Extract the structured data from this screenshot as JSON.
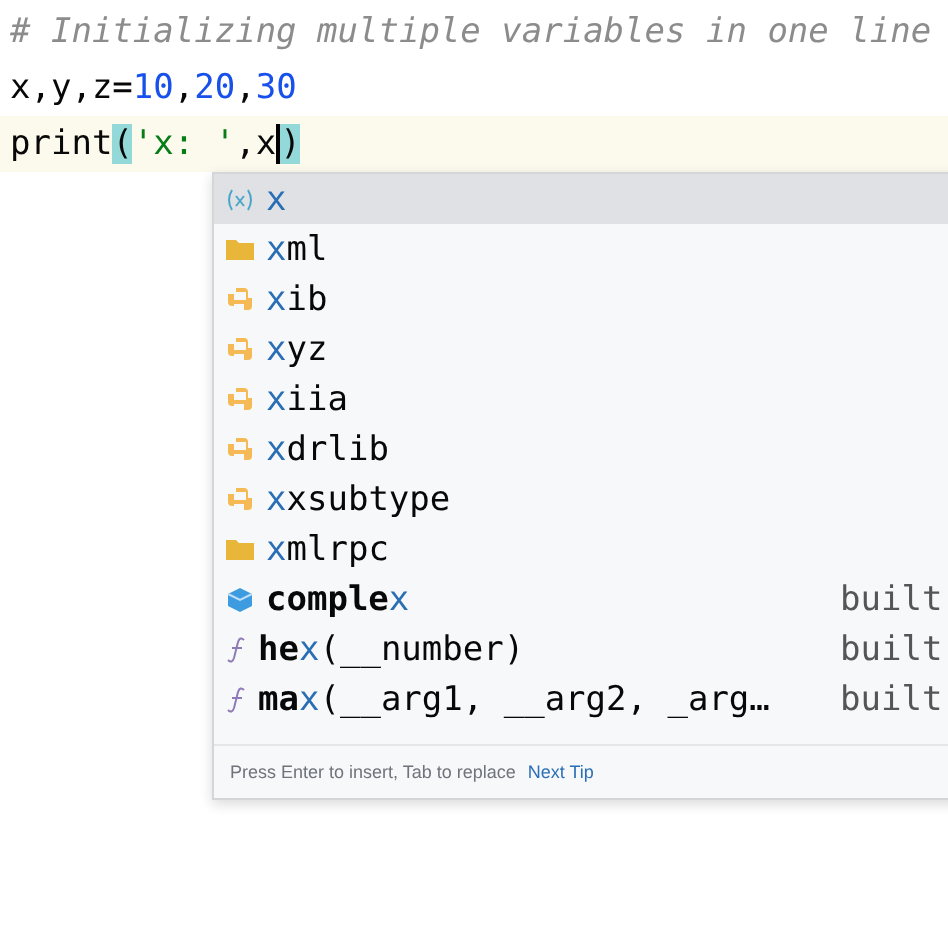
{
  "editor": {
    "lines": [
      [
        {
          "kind": "comment",
          "text": "# Initializing multiple variables in one line"
        }
      ],
      [
        {
          "kind": "plain",
          "text": "x,y,z="
        },
        {
          "kind": "number",
          "text": "10"
        },
        {
          "kind": "plain",
          "text": ","
        },
        {
          "kind": "number",
          "text": "20"
        },
        {
          "kind": "plain",
          "text": ","
        },
        {
          "kind": "number",
          "text": "30"
        }
      ],
      [
        {
          "kind": "plain",
          "text": "print"
        },
        {
          "kind": "brace",
          "text": "("
        },
        {
          "kind": "string",
          "text": "'x: '"
        },
        {
          "kind": "plain",
          "text": ",x"
        },
        {
          "kind": "caret"
        },
        {
          "kind": "brace",
          "text": ")"
        }
      ]
    ]
  },
  "completion": {
    "items": [
      {
        "kind": "variable",
        "match": "x",
        "selected": true
      },
      {
        "kind": "folder",
        "match": "x",
        "after": "ml",
        "selected": false
      },
      {
        "kind": "package",
        "match": "x",
        "after": "ib",
        "selected": false
      },
      {
        "kind": "package",
        "match": "x",
        "after": "yz",
        "selected": false
      },
      {
        "kind": "package",
        "match": "x",
        "after": "iia",
        "selected": false
      },
      {
        "kind": "package",
        "match": "x",
        "after": "drlib",
        "selected": false
      },
      {
        "kind": "package",
        "match": "x",
        "after": "xsubtype",
        "selected": false
      },
      {
        "kind": "folder",
        "match": "x",
        "after": "mlrpc",
        "selected": false
      },
      {
        "kind": "class",
        "before": "comple",
        "match": "x",
        "type": "built",
        "selected": false
      },
      {
        "kind": "function",
        "before": "he",
        "match": "x",
        "after": "(__number)",
        "type": "built",
        "selected": false
      },
      {
        "kind": "function",
        "before": "ma",
        "match": "x",
        "after": "(__arg1, __arg2, _arg…",
        "type": "built",
        "selected": false
      }
    ],
    "hint": "Press Enter to insert, Tab to replace",
    "hint_link": "Next Tip"
  }
}
